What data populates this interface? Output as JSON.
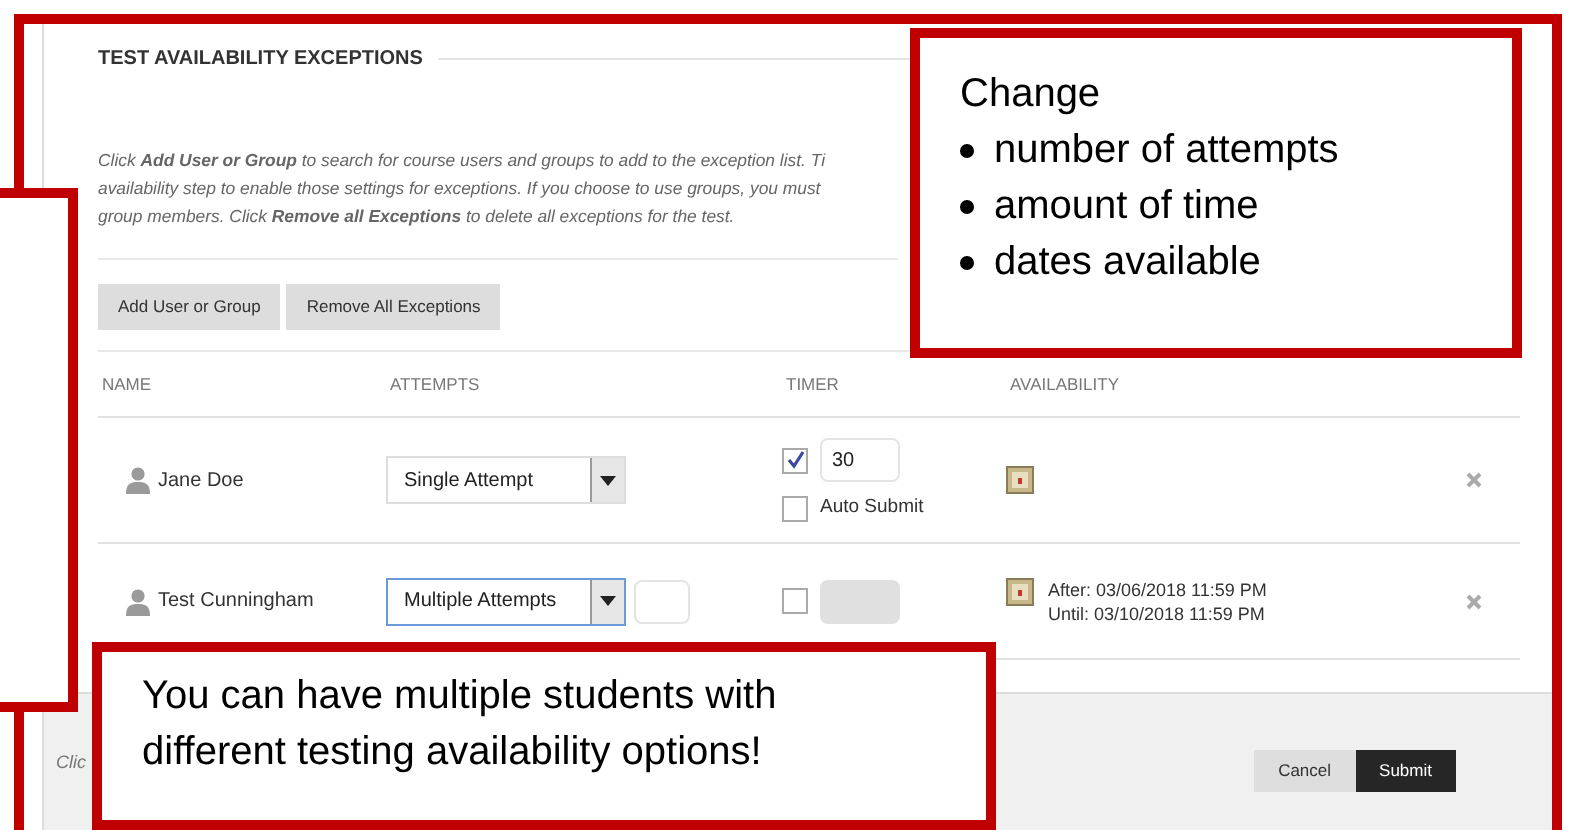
{
  "section_title": "TEST AVAILABILITY EXCEPTIONS",
  "instructions": [
    "Click **Add User or Group** to search for course users and groups to add to the exception list. Ti",
    "availability step to enable those settings for exceptions. If you choose to use groups, you must",
    "group members. Click **Remove all Exceptions** to delete all exceptions for the test."
  ],
  "buttons": [
    "Add User or Group",
    "Remove All Exceptions"
  ],
  "table": {
    "columns": [
      "NAME",
      "ATTEMPTS",
      "TIMER",
      "AVAILABILITY"
    ],
    "rows": [
      {
        "name": "Jane Doe",
        "attempts": "Single Attempt",
        "focused": false,
        "attempt_count_field": false,
        "timer_checked": true,
        "timer_minutes": "30",
        "auto_submit": {
          "label": "Auto Submit",
          "checked": false
        },
        "availability": []
      },
      {
        "name": "Test Cunningham",
        "attempts": "Multiple Attempts",
        "focused": true,
        "attempt_count_field": true,
        "timer_checked": false,
        "availability": [
          "After: 03/06/2018 11:59 PM",
          "Until: 03/10/2018 11:59 PM"
        ]
      }
    ]
  },
  "footer": {
    "hint": "Clic",
    "buttons": [
      {
        "label": "Cancel",
        "kind": "secondary"
      },
      {
        "label": "Submit",
        "kind": "primary"
      }
    ]
  },
  "callouts": [
    {
      "kind": "list",
      "title": "Change",
      "items": [
        "number of attempts",
        "amount of time",
        "dates available"
      ]
    },
    {
      "kind": "text",
      "text": "You can have multiple students with different testing availability options!"
    },
    {
      "kind": "blank"
    }
  ]
}
